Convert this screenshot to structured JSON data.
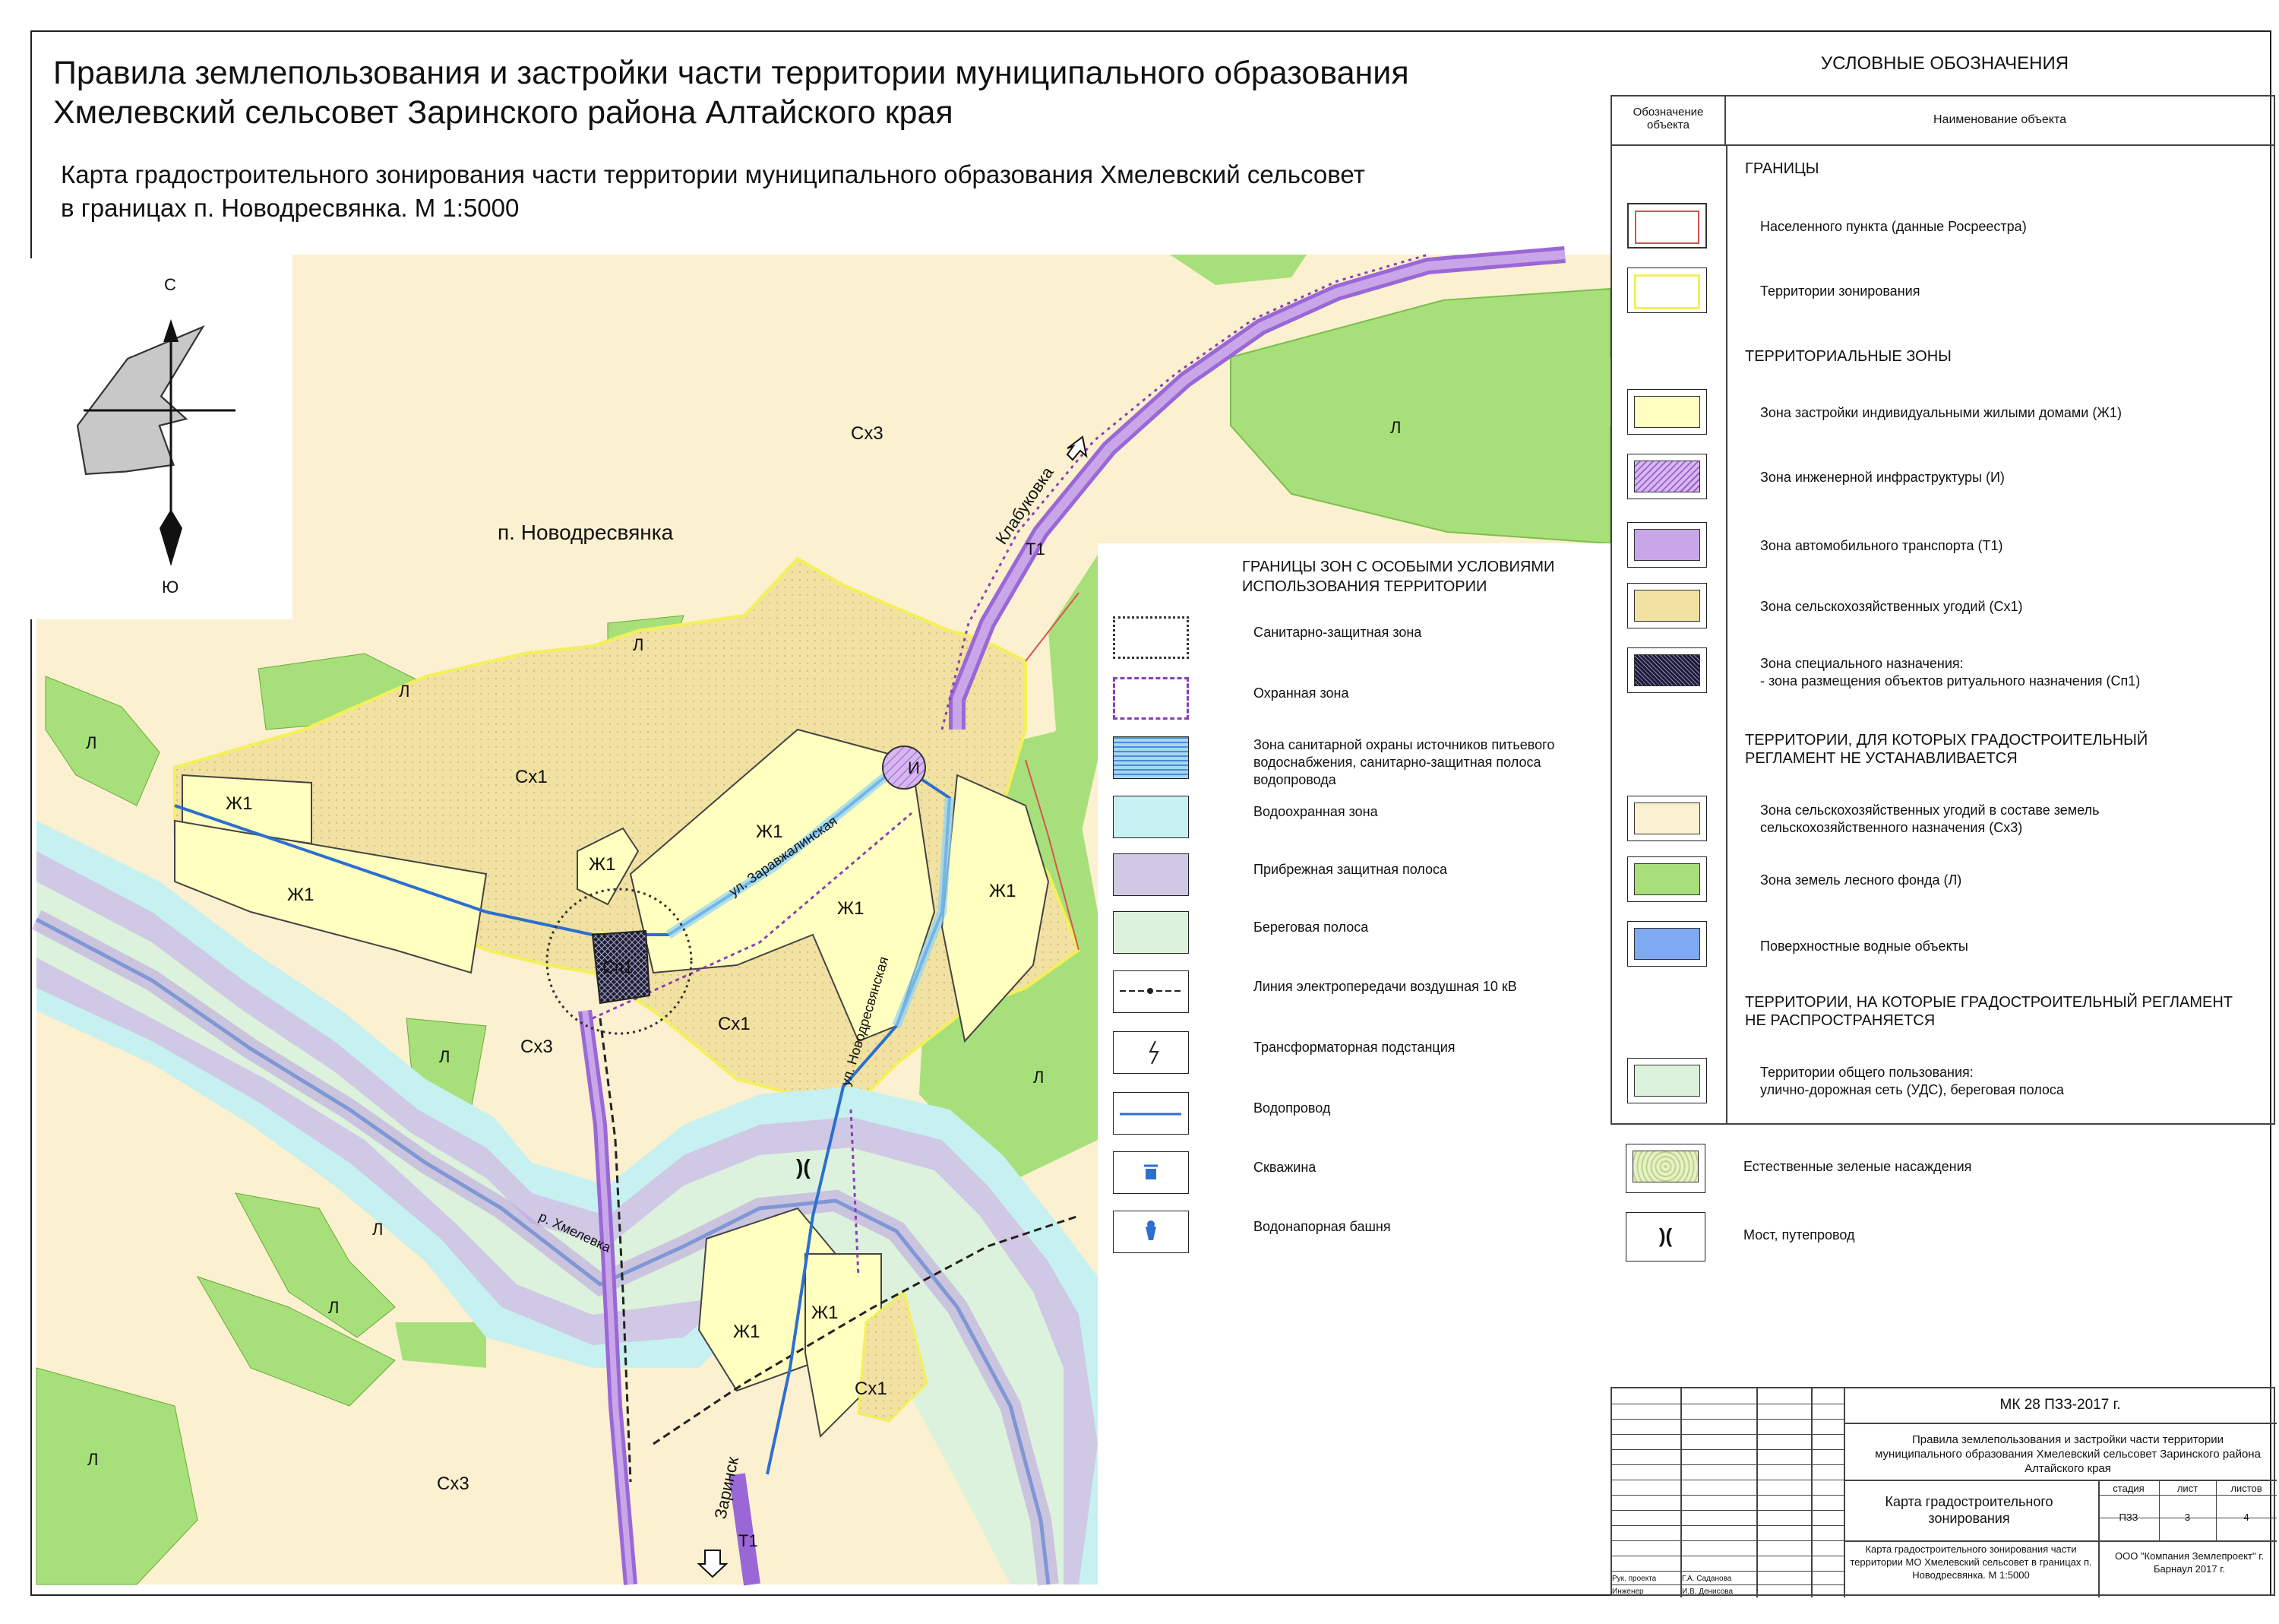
{
  "title": {
    "line1": "Правила землепользования и застройки части территории муниципального образования",
    "line2": "Хмелевский сельсовет Заринского района Алтайского края"
  },
  "subtitle": {
    "line1": "Карта градостроительного зонирования части территории муниципального образования Хмелевский сельсовет",
    "line2": "в границах п. Новодресвянка. М 1:5000"
  },
  "compass": {
    "north": "С",
    "south": "Ю"
  },
  "map_labels": {
    "settlement": "п. Новодресвянка",
    "zone_sx3": "Сх3",
    "zone_sx1": "Сх1",
    "zone_zh1": "Ж1",
    "zone_l": "Л",
    "zone_t1": "Т1",
    "zone_i": "И",
    "zone_sp1": "Сп1",
    "road_klabukovka": "Клабуковка",
    "road_zarinsk": "Заринск",
    "street_1": "ул. Новодресвянская",
    "street_2": "ул. Заравжалинская",
    "river": "р. Хмелевка",
    "bridge": ")("
  },
  "inner_legend": {
    "title": "ГРАНИЦЫ ЗОН С ОСОБЫМИ УСЛОВИЯМИ ИСПОЛЬЗОВАНИЯ ТЕРРИТОРИИ",
    "items": [
      {
        "label": "Санитарно-защитная зона",
        "icon": "sanitary-zone-icon"
      },
      {
        "label": "Охранная зона",
        "icon": "protection-zone-icon"
      },
      {
        "label": "Зона санитарной охраны источников питьевого водоснабжения, санитарно-защитная полоса водопровода",
        "icon": "water-protection-icon"
      },
      {
        "label": "Водоохранная зона",
        "icon": "water-zone-icon"
      },
      {
        "label": "Прибрежная защитная полоса",
        "icon": "coastal-strip-icon"
      },
      {
        "label": "Береговая полоса",
        "icon": "shore-strip-icon"
      },
      {
        "label": "Линия электропередачи воздушная 10 кВ",
        "icon": "power-line-icon"
      },
      {
        "label": "Трансформаторная подстанция",
        "icon": "substation-icon"
      },
      {
        "label": "Водопровод",
        "icon": "water-pipe-icon"
      },
      {
        "label": "Скважина",
        "icon": "well-icon"
      },
      {
        "label": "Водонапорная башня",
        "icon": "water-tower-icon"
      }
    ]
  },
  "right_legend": {
    "title": "УСЛОВНЫЕ ОБОЗНАЧЕНИЯ",
    "col1": "Обозначение объекта",
    "col2": "Наименование объекта",
    "sec_borders": "ГРАНИЦЫ",
    "sec_zones": "ТЕРРИТОРИАЛЬНЫЕ ЗОНЫ",
    "sec_noreg": "ТЕРРИТОРИИ, ДЛЯ КОТОРЫХ ГРАДОСТРОИТЕЛЬНЫЙ РЕГЛАМЕНТ НЕ УСТАНАВЛИВАЕТСЯ",
    "sec_nonapp": "ТЕРРИТОРИИ, НА КОТОРЫЕ ГРАДОСТРОИТЕЛЬНЫЙ РЕГЛАМЕНТ НЕ РАСПРОСТРАНЯЕТСЯ",
    "border_items": [
      "Населенного пункта (данные Росреестра)",
      "Территории зонирования"
    ],
    "zone_items": [
      "Зона застройки индивидуальными жилыми домами (Ж1)",
      "Зона инженерной инфраструктуры (И)",
      "Зона автомобильного транспорта (Т1)",
      "Зона сельскохозяйственных угодий  (Сх1)",
      "Зона специального назначения:\n- зона размещения объектов ритуального назначения (Сп1)"
    ],
    "noreg_items": [
      "Зона сельскохозяйственных угодий в составе земель сельскохозяйственного назначения (Сх3)",
      "Зона земель лесного фонда (Л)",
      "Поверхностные водные объекты"
    ],
    "nonapp_items": [
      "Территории общего пользования:\nулично-дорожная сеть (УДС), береговая полоса"
    ],
    "extra_items": [
      "Естественные зеленые насаждения",
      "Мост, путепровод"
    ]
  },
  "title_block": {
    "code": "МК 28 ПЗЗ-2017 г.",
    "project": "Правила землепользования и застройки  части территории муниципального образования Хмелевский сельсовет Заринского района Алтайского края",
    "sheet_name": "Карта градостроительного зонирования",
    "stage_h": "стадия",
    "sheet_h": "лист",
    "sheets_h": "листов",
    "stage": "ПЗЗ",
    "sheet": "3",
    "sheets": "4",
    "desc": "Карта градостроительного зонирования части территории МО Хмелевский сельсовет в границах п. Новодресвянка. М 1:5000",
    "company": "ООО \"Компания Землепроект\" г. Барнаул 2017 г.",
    "role1": "Рук. проекта",
    "name1": "Г.А. Саданова",
    "role2": "Инженер",
    "name2": "И.В. Денисова"
  },
  "colors": {
    "zh1": "#ffffc0",
    "sx1": "#f1e2a3",
    "sx3": "#fbf0cf",
    "forest": "#a7e07a",
    "t1": "#c9a6e8",
    "water_zone": "#c6f1f0",
    "coastal": "#cfc9e6",
    "shore": "#ddf2dc",
    "settlement_border": "#d9534f",
    "zoning_border": "#f3f05a"
  }
}
